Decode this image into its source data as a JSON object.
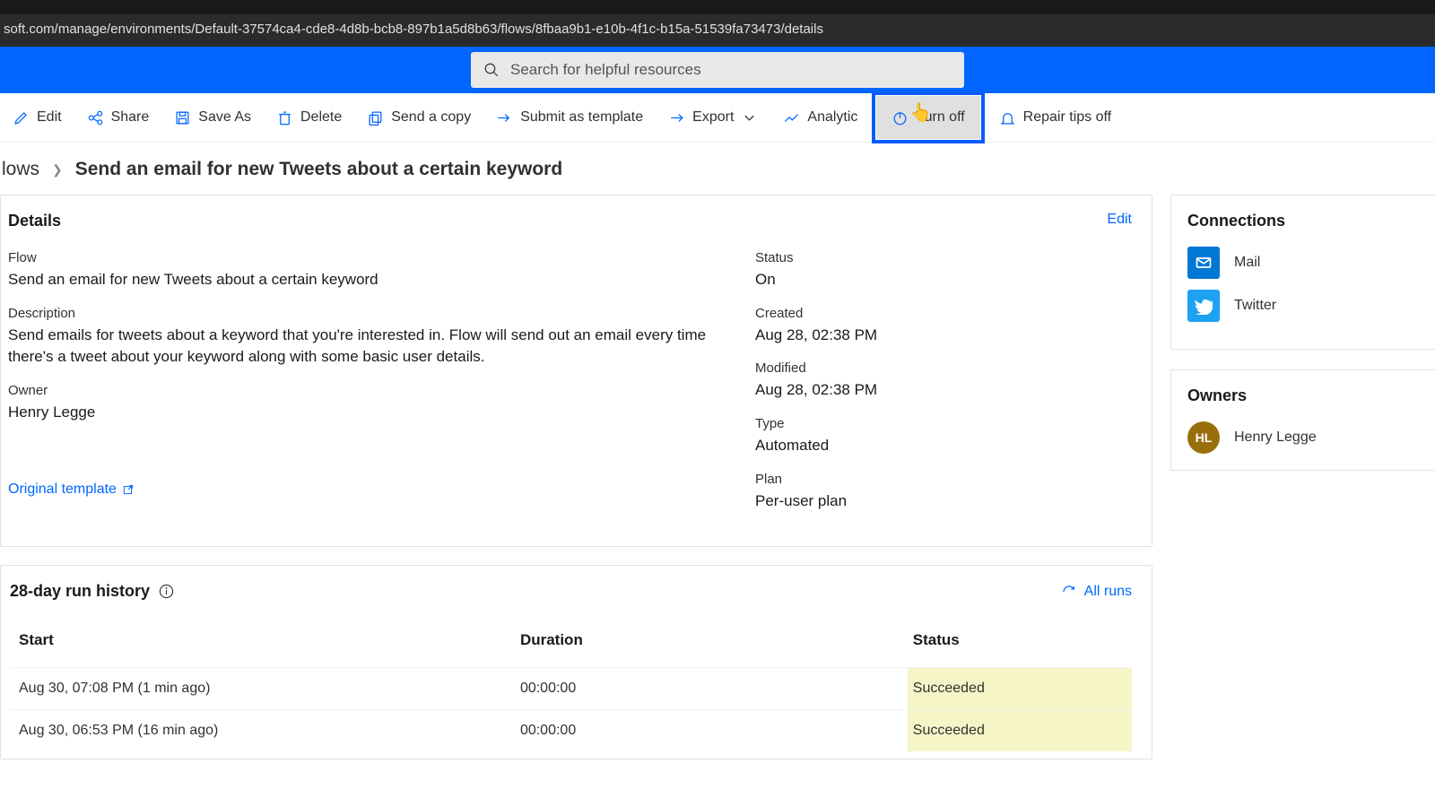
{
  "url": "soft.com/manage/environments/Default-37574ca4-cde8-4d8b-bcb8-897b1a5d8b63/flows/8fbaa9b1-e10b-4f1c-b15a-51539fa73473/details",
  "search": {
    "placeholder": "Search for helpful resources"
  },
  "toolbar": {
    "edit": "Edit",
    "share": "Share",
    "save_as": "Save As",
    "delete": "Delete",
    "send_copy": "Send a copy",
    "submit_template": "Submit as template",
    "export": "Export",
    "analytics": "Analytic",
    "turn_off": "Turn off",
    "repair_tips": "Repair tips off"
  },
  "breadcrumb": {
    "parent": "lows",
    "title": "Send an email for new Tweets about a certain keyword"
  },
  "details": {
    "heading": "Details",
    "edit_link": "Edit",
    "flow_label": "Flow",
    "flow_value": "Send an email for new Tweets about a certain keyword",
    "description_label": "Description",
    "description_value": "Send emails for tweets about a keyword that you're interested in. Flow will send out an email every time there's a tweet about your keyword along with some basic user details.",
    "owner_label": "Owner",
    "owner_value": "Henry Legge",
    "status_label": "Status",
    "status_value": "On",
    "created_label": "Created",
    "created_value": "Aug 28, 02:38 PM",
    "modified_label": "Modified",
    "modified_value": "Aug 28, 02:38 PM",
    "type_label": "Type",
    "type_value": "Automated",
    "plan_label": "Plan",
    "plan_value": "Per-user plan",
    "original_template": "Original template"
  },
  "history": {
    "heading": "28-day run history",
    "all_runs": "All runs",
    "col_start": "Start",
    "col_duration": "Duration",
    "col_status": "Status",
    "rows": [
      {
        "start": "Aug 30, 07:08 PM (1 min ago)",
        "duration": "00:00:00",
        "status": "Succeeded"
      },
      {
        "start": "Aug 30, 06:53 PM (16 min ago)",
        "duration": "00:00:00",
        "status": "Succeeded"
      }
    ]
  },
  "connections": {
    "heading": "Connections",
    "mail": "Mail",
    "twitter": "Twitter"
  },
  "owners": {
    "heading": "Owners",
    "initials": "HL",
    "name": "Henry Legge"
  }
}
